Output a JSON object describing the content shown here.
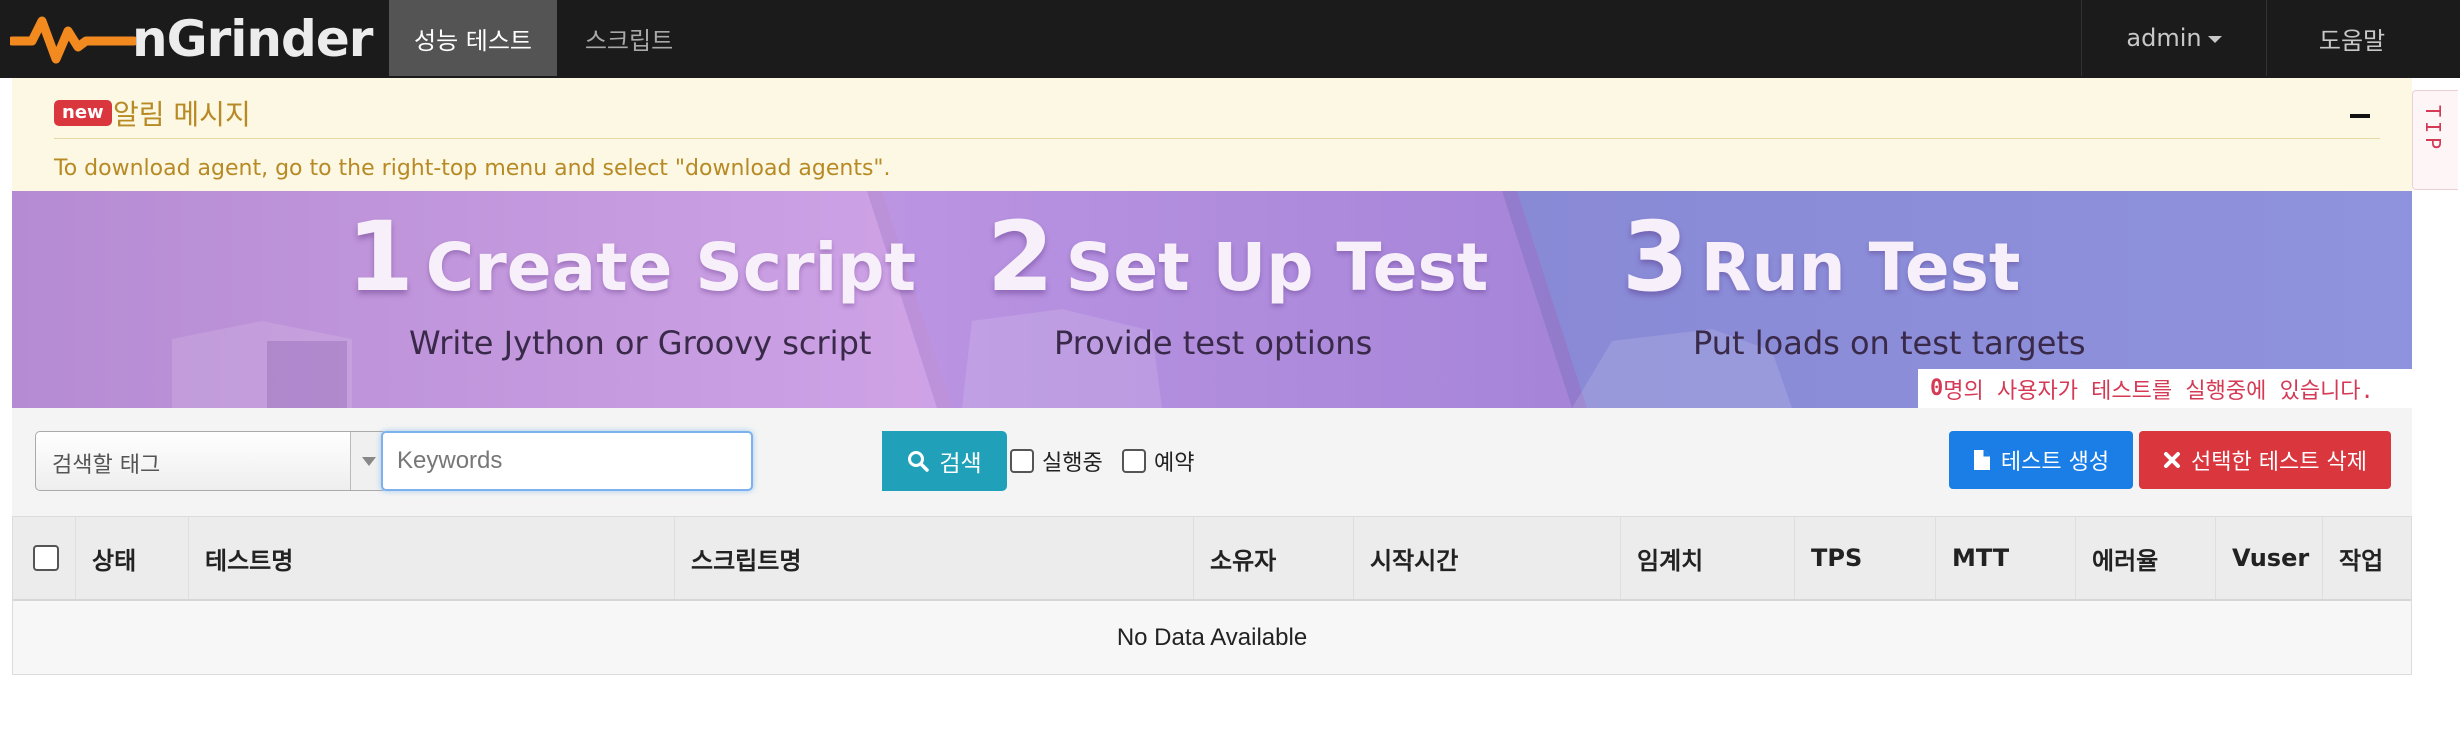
{
  "navbar": {
    "brand": "nGrinder",
    "menu": [
      {
        "label": "성능 테스트",
        "active": true
      },
      {
        "label": "스크립트",
        "active": false
      }
    ],
    "user_menu": "admin",
    "help": "도움말"
  },
  "alert": {
    "badge": "new",
    "title": "알림 메시지",
    "message": "To download agent, go to the right-top menu and select \"download agents\"."
  },
  "tip_label": "TIP",
  "banner": {
    "steps": [
      {
        "number": "1",
        "title": "Create Script",
        "subtitle": "Write Jython or Groovy script"
      },
      {
        "number": "2",
        "title": "Set Up Test",
        "subtitle": "Provide test options"
      },
      {
        "number": "3",
        "title": "Run Test",
        "subtitle": "Put loads on test targets"
      }
    ],
    "running_count": "0",
    "running_text": " 명의 사용자가 테스트를 실행중에 있습니다."
  },
  "toolbar": {
    "tag_placeholder": "검색할 태그",
    "keyword_placeholder": "Keywords",
    "search_label": "검색",
    "filter_running": "실행중",
    "filter_scheduled": "예약",
    "create_label": "테스트 생성",
    "delete_label": "선택한 테스트 삭제"
  },
  "table": {
    "columns": [
      "상태",
      "테스트명",
      "스크립트명",
      "소유자",
      "시작시간",
      "임계치",
      "TPS",
      "MTT",
      "에러율",
      "Vuser",
      "작업"
    ],
    "empty_text": "No Data Available"
  },
  "colors": {
    "navbar_bg": "#1b1b1b",
    "alert_bg": "#fcf8e3",
    "alert_text": "#b78a25",
    "primary": "#1a7ee6",
    "danger": "#d9363e",
    "info": "#21a1b9",
    "logo_orange": "#f28a1f"
  }
}
